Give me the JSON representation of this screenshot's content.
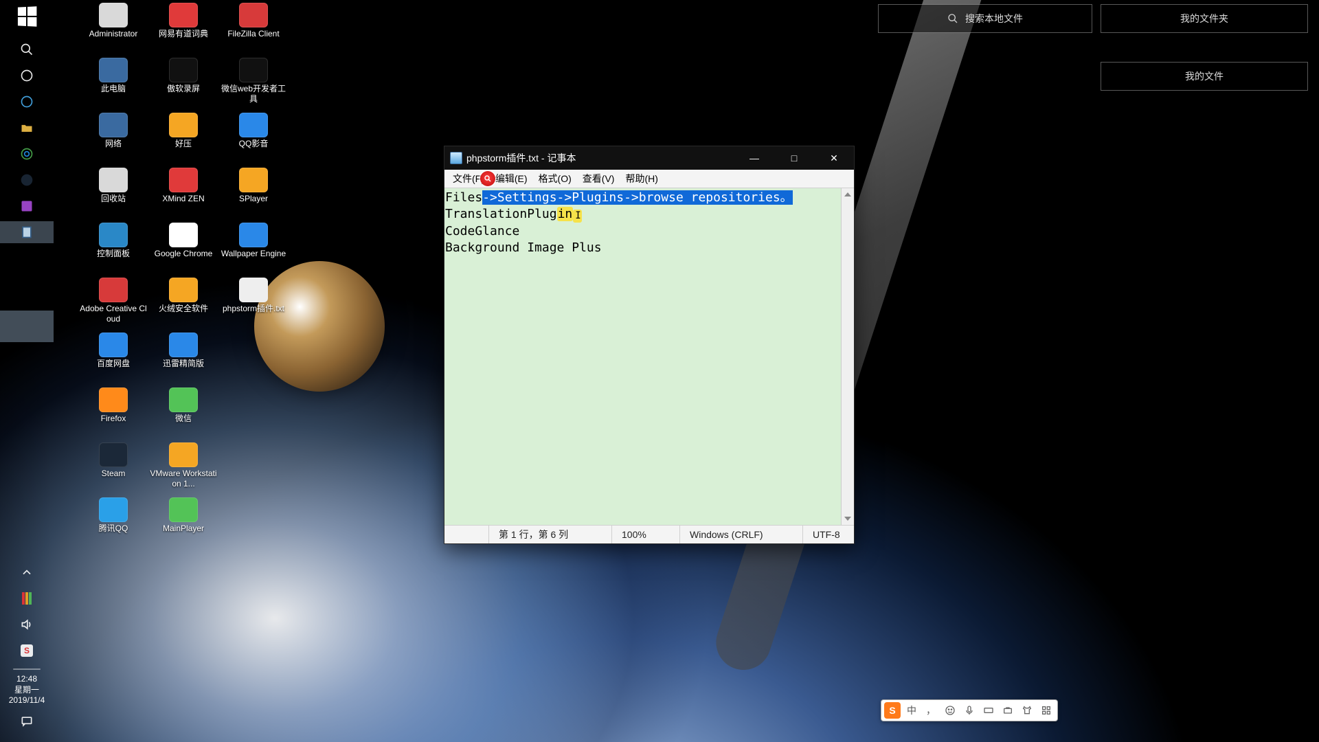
{
  "wallpaper": {
    "name": "earth-iss"
  },
  "taskbar": {
    "datetime": {
      "time": "12:48",
      "weekday": "星期一",
      "date": "2019/11/4"
    }
  },
  "topRight": {
    "searchPlaceholder": "搜索本地文件",
    "panel1": "我的文件夹",
    "panel2": "我的文件"
  },
  "desktopIcons": {
    "col0": [
      {
        "label": "Administrator",
        "bg": "#d9d9d9"
      },
      {
        "label": "此电脑",
        "bg": "#3a6aa0"
      },
      {
        "label": "网络",
        "bg": "#3a6aa0"
      },
      {
        "label": "回收站",
        "bg": "#d9d9d9"
      },
      {
        "label": "控制面板",
        "bg": "#2a88c7"
      },
      {
        "label": "Adobe Creative Cloud",
        "bg": "#d73a3a"
      },
      {
        "label": "百度网盘",
        "bg": "#2a88e8"
      },
      {
        "label": "Firefox",
        "bg": "#ff8a1a"
      },
      {
        "label": "Steam",
        "bg": "#1b2838"
      },
      {
        "label": "腾讯QQ",
        "bg": "#2aa0e8"
      }
    ],
    "col1": [
      {
        "label": "网易有道词典",
        "bg": "#e03a3a"
      },
      {
        "label": "傲软录屏",
        "bg": "#111111"
      },
      {
        "label": "好压",
        "bg": "#f5a623"
      },
      {
        "label": "XMind ZEN",
        "bg": "#e03a3a"
      },
      {
        "label": "Google Chrome",
        "bg": "#ffffff"
      },
      {
        "label": "火绒安全软件",
        "bg": "#f5a623"
      },
      {
        "label": "迅雷精简版",
        "bg": "#2a88e8"
      },
      {
        "label": "微信",
        "bg": "#53c357"
      },
      {
        "label": "VMware Workstation 1...",
        "bg": "#f5a623"
      },
      {
        "label": "MainPlayer",
        "bg": "#53c357"
      }
    ],
    "col2": [
      {
        "label": "FileZilla Client",
        "bg": "#d73a3a"
      },
      {
        "label": "微信web开发者工具",
        "bg": "#111111"
      },
      {
        "label": "QQ影音",
        "bg": "#2a88e8"
      },
      {
        "label": "SPlayer",
        "bg": "#f5a623"
      },
      {
        "label": "Wallpaper Engine",
        "bg": "#2a88e8"
      },
      {
        "label": "phpstorm插件.txt",
        "bg": "#eeeeee"
      }
    ]
  },
  "notepad": {
    "title": "phpstorm插件.txt - 记事本",
    "menu": {
      "file": "文件(F)",
      "edit": "编辑(E)",
      "format": "格式(O)",
      "view": "查看(V)",
      "help": "帮助(H)"
    },
    "content": {
      "line1_lead": "Files",
      "line1_selected": "->Settings->Plugins->browse repositories。",
      "line2_plain": "TranslationPlug",
      "line2_hl": "in",
      "line2_caret": "I",
      "line3": "CodeGlance",
      "line4": "Background Image Plus"
    },
    "status": {
      "position": "第 1 行，第 6 列",
      "zoom": "100%",
      "eol": "Windows (CRLF)",
      "encoding": "UTF-8"
    }
  },
  "ime": {
    "brand": "S",
    "lang": "中",
    "punct": "，",
    "items": [
      "emoji",
      "mic",
      "keyboard",
      "toolbox",
      "shirt",
      "grid"
    ]
  }
}
